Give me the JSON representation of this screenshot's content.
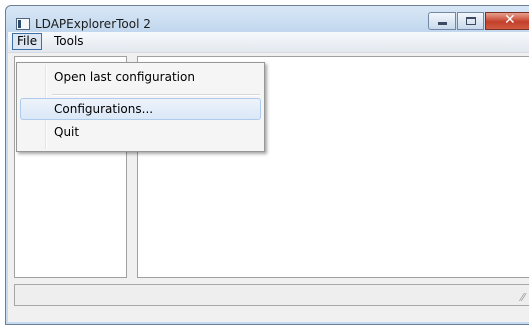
{
  "window": {
    "title": "LDAPExplorerTool 2",
    "caption_buttons": {
      "minimize": "minimize-icon",
      "maximize": "maximize-icon",
      "close_glyph": "✕"
    }
  },
  "menubar": {
    "items": [
      {
        "label": "File"
      },
      {
        "label": "Tools"
      }
    ]
  },
  "file_menu": {
    "items": [
      {
        "label": "Open last configuration"
      },
      {
        "label": "Configurations..."
      },
      {
        "label": "Quit"
      }
    ],
    "highlighted": "Configurations..."
  },
  "statusbar": {
    "grip_glyph": "⁄⁄"
  },
  "colors": {
    "titlebar": "#c4daf0",
    "close_button": "#c4402a",
    "menu_highlight": "#dbe8f7"
  }
}
